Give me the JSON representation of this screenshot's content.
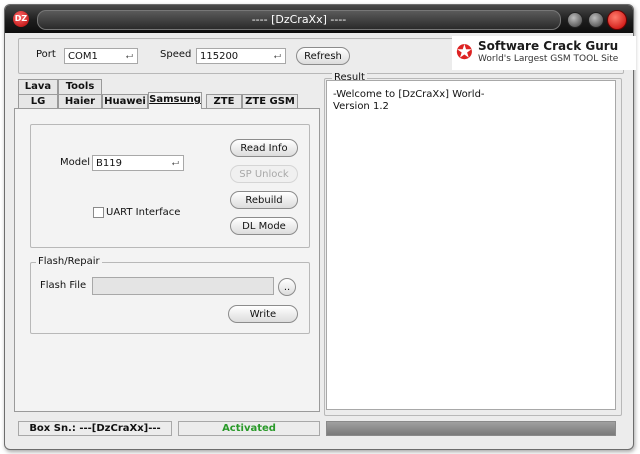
{
  "window": {
    "title": "---- [DzCraXx] ----",
    "app_icon": "app-logo-icon"
  },
  "connection": {
    "port_label": "Port",
    "port_value": "COM1",
    "speed_label": "Speed",
    "speed_value": "115200",
    "refresh_label": "Refresh"
  },
  "logo": {
    "line1": "Software Crack Guru",
    "line2": "World's Largest GSM TOOL Site"
  },
  "tabs": {
    "row1": [
      "Lava",
      "Tools"
    ],
    "row2": [
      "LG",
      "Haier",
      "Huawei",
      "Samsung",
      "ZTE",
      "ZTE GSM"
    ],
    "active": "Samsung"
  },
  "samsung": {
    "model_label": "Model",
    "model_value": "B119",
    "read_info_label": "Read Info",
    "sp_unlock_label": "SP Unlock",
    "rebuild_label": "Rebuild",
    "dl_mode_label": "DL Mode",
    "uart_label": "UART Interface",
    "uart_checked": false
  },
  "flash": {
    "group_label": "Flash/Repair",
    "file_label": "Flash File",
    "file_value": "",
    "browse_label": "..",
    "write_label": "Write"
  },
  "result": {
    "label": "Result",
    "lines": [
      "-Welcome to [DzCraXx] World-",
      "Version 1.2"
    ]
  },
  "status": {
    "box_sn": "Box Sn.: ---[DzCraXx]---",
    "activation": "Activated",
    "activation_color": "#2a9a2a",
    "progress": 0
  }
}
